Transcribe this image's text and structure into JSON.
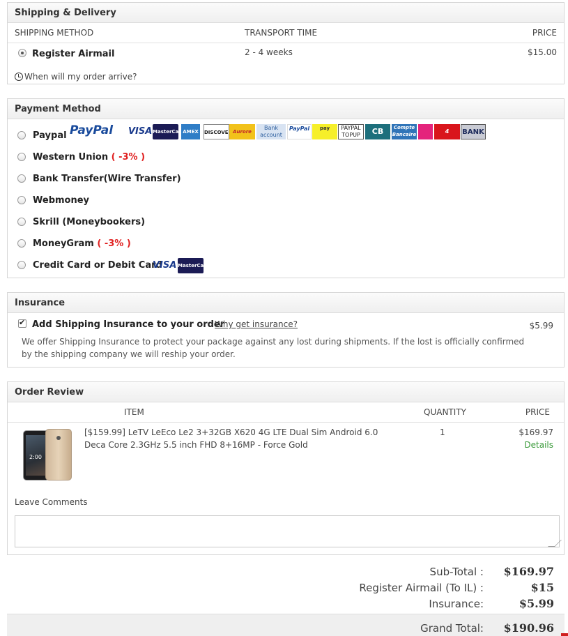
{
  "shipping": {
    "title": "Shipping & Delivery",
    "col_method": "SHIPPING METHOD",
    "col_time": "TRANSPORT TIME",
    "col_price": "PRICE",
    "method": "Register Airmail",
    "time": "2 - 4 weeks",
    "price": "$15.00",
    "arrive_link": "When will my order arrive?"
  },
  "payment": {
    "title": "Payment Method",
    "methods": [
      {
        "label": "Paypal",
        "discount": ""
      },
      {
        "label": "Western Union",
        "discount": "( -3% )"
      },
      {
        "label": "Bank Transfer(Wire Transfer)",
        "discount": ""
      },
      {
        "label": "Webmoney",
        "discount": ""
      },
      {
        "label": "Skrill (Moneybookers)",
        "discount": ""
      },
      {
        "label": "MoneyGram",
        "discount": "( -3% )"
      },
      {
        "label": "Credit Card or Debit Card",
        "discount": ""
      }
    ],
    "logos": {
      "paypal": "PayPal",
      "visa": "VISA",
      "mastercard": "MasterCard",
      "amex": "AMEX",
      "discover": "DISCOVER",
      "aurore": "Aurore",
      "bank_account": "Bank account",
      "paypal_small": "PayPal",
      "pay_yellow": "pay",
      "paypal_topup": "PAYPAL TOPUP",
      "cb": "CB",
      "compte_bancaire": "Compte Bancaire",
      "pink": "",
      "quatre_etoiles": "4 étoiles",
      "bank": "BANK"
    },
    "colors": {
      "discount": "#e02020"
    }
  },
  "insurance": {
    "title": "Insurance",
    "label": "Add Shipping Insurance to your order",
    "why_link": "Why get insurance?",
    "price": "$5.99",
    "description": "We offer Shipping Insurance to protect your package against any lost during shipments. If the lost is officially confirmed by the shipping company we will reship your order.",
    "checked": true
  },
  "order": {
    "title": "Order Review",
    "col_item": "ITEM",
    "col_qty": "QUANTITY",
    "col_price": "PRICE",
    "item_name": "[$159.99] LeTV LeEco Le2 3+32GB X620 4G LTE Dual Sim Android 6.0 Deca Core 2.3GHz 5.5 inch FHD 8+16MP - Force Gold",
    "qty": "1",
    "price": "$169.97",
    "details_link": "Details",
    "phone_time": "2:00",
    "comments_label": "Leave Comments",
    "comments_value": ""
  },
  "totals": {
    "subtotal_label": "Sub-Total :",
    "subtotal": "$169.97",
    "shipping_label": "Register Airmail (To IL) :",
    "shipping": "$15",
    "insurance_label": "Insurance:",
    "insurance": "$5.99",
    "grand_label": "Grand Total:",
    "grand": "$190.96"
  }
}
